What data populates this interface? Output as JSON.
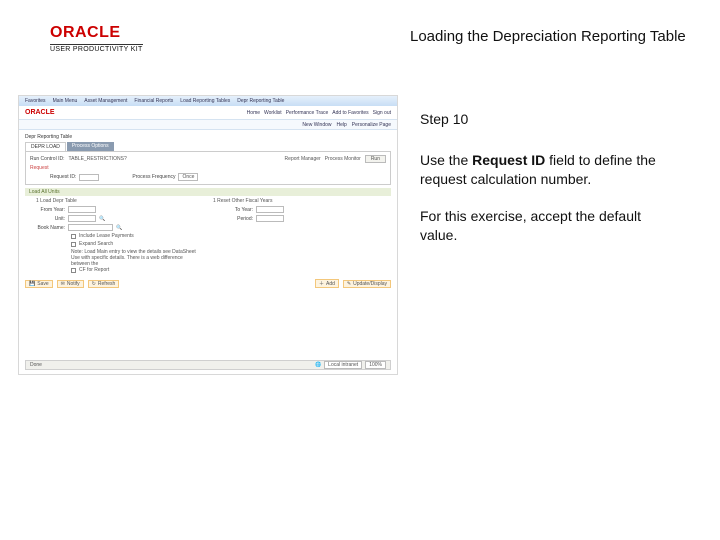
{
  "logo": {
    "brand": "ORACLE",
    "subline": "USER PRODUCTIVITY KIT"
  },
  "page_title": "Loading the Depreciation Reporting Table",
  "instructions": {
    "step_label": "Step 10",
    "para1_a": "Use the ",
    "para1_bold": "Request ID",
    "para1_b": " field to define the request calculation number.",
    "para2": "For this exercise, accept the default value."
  },
  "ss": {
    "top_menu": [
      "Favorites",
      "Main Menu",
      "Asset Management",
      "Financial Reports",
      "Load Reporting Tables",
      "Depr Reporting Table"
    ],
    "top_right": [
      "Home",
      "Worklist",
      "Performance Trace",
      "Add to Favorites",
      "Sign out"
    ],
    "brand": "ORACLE",
    "under_logo_right": [
      "New Window",
      "Help",
      "Personalize Page"
    ],
    "section_title": "Depr Reporting Table",
    "tabs": [
      "DEPR LOAD",
      "Process Options"
    ],
    "run_line": {
      "run_id_label": "Run Control ID:",
      "run_id_value": "TABLE_RESTRICTIONS?",
      "report_mgr": "Report Manager",
      "process_mon": "Process Monitor",
      "run_btn": "Run"
    },
    "request_row": {
      "request_label": "Request",
      "request_id_label": "Request ID:",
      "process_freq_label": "Process Frequency",
      "process_freq_value": "Once"
    },
    "green_header": "Load All Units",
    "left_fields": {
      "load_depr": "1  Load Depr Table",
      "from_year_label": "From Year:",
      "unit_label": "Unit:",
      "book_name_label": "Book Name:",
      "cb1": "Include Lease Payments",
      "cb2": "Expand Search",
      "note1": "Note: Load Main entry to view the details see DataSheet",
      "note2": "Use with specific details. There is a web difference between the",
      "cb3": "CF for Report"
    },
    "right_fields": {
      "reset_other": "1  Reset Other Fiscal Years",
      "to_year_label": "To Year:",
      "period_label": "Period:"
    },
    "bottom": {
      "save": "Save",
      "notify": "Notify",
      "refresh": "Refresh",
      "add": "Add",
      "update": "Update/Display"
    },
    "status": {
      "done": "Done",
      "dd1": "Local intranet",
      "dd2": "100%"
    }
  }
}
